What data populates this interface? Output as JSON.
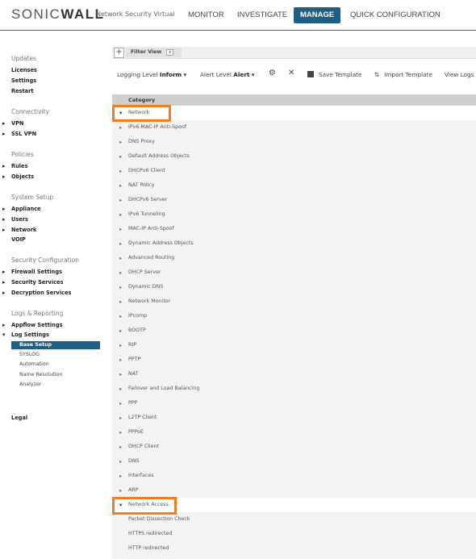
{
  "brand": {
    "logo_text_1": "SONIC",
    "logo_text_2": "WALL",
    "product": "Network Security Virtual"
  },
  "nav": {
    "monitor": "MONITOR",
    "investigate": "INVESTIGATE",
    "manage": "MANAGE",
    "quick_config": "QUICK CONFIGURATION"
  },
  "sidebar": {
    "updates": {
      "title": "Updates",
      "items": [
        "Licenses",
        "Settings",
        "Restart"
      ]
    },
    "connectivity": {
      "title": "Connectivity",
      "items": [
        "VPN",
        "SSL VPN"
      ]
    },
    "policies": {
      "title": "Policies",
      "items": [
        "Rules",
        "Objects"
      ]
    },
    "system_setup": {
      "title": "System Setup",
      "items": [
        "Appliance",
        "Users",
        "Network",
        "VOIP"
      ]
    },
    "security_config": {
      "title": "Security Configuration",
      "items": [
        "Firewall Settings",
        "Security Services",
        "Decryption Services"
      ]
    },
    "logs": {
      "title": "Logs & Reporting",
      "items": [
        "Appflow Settings",
        "Log Settings"
      ],
      "sub": [
        "Base Setup",
        "SYSLOG",
        "Automation",
        "Name Resolution",
        "Analyzer"
      ]
    },
    "legal": "Legal"
  },
  "filter": {
    "plus": "+",
    "label": "Filter View"
  },
  "toolbar": {
    "logging_level_label": "Logging Level",
    "logging_level_value": "Inform",
    "alert_level_label": "Alert Level",
    "alert_level_value": "Alert",
    "save_template": "Save Template",
    "import_template": "Import Template",
    "view_logs": "View Logs"
  },
  "grid": {
    "header": "Category",
    "network": "Network",
    "network_children": [
      "IPv6 MAC-IP Anti-Spoof",
      "DNS Proxy",
      "Default Address Objects",
      "DHCPv6 Client",
      "NAT Policy",
      "DHCPv6 Server",
      "IPv6 Tunneling",
      "MAC-IP Anti-Spoof",
      "Dynamic Address Objects",
      "Advanced Routing",
      "DHCP Server",
      "Dynamic DNS",
      "Network Monitor",
      "IPcomp",
      "BOOTP",
      "RIP",
      "PPTP",
      "NAT",
      "Failover and Load Balancing",
      "PPP",
      "L2TP Client",
      "PPPoE",
      "DHCP Client",
      "DNS",
      "Interfaces",
      "ARP"
    ],
    "network_access": "Network Access",
    "network_access_children": [
      "Packet Dissection Check",
      "HTTPS redirected",
      "HTTP redirected"
    ]
  },
  "colors": {
    "accent": "#1f5f86",
    "highlight": "#f47b20"
  }
}
